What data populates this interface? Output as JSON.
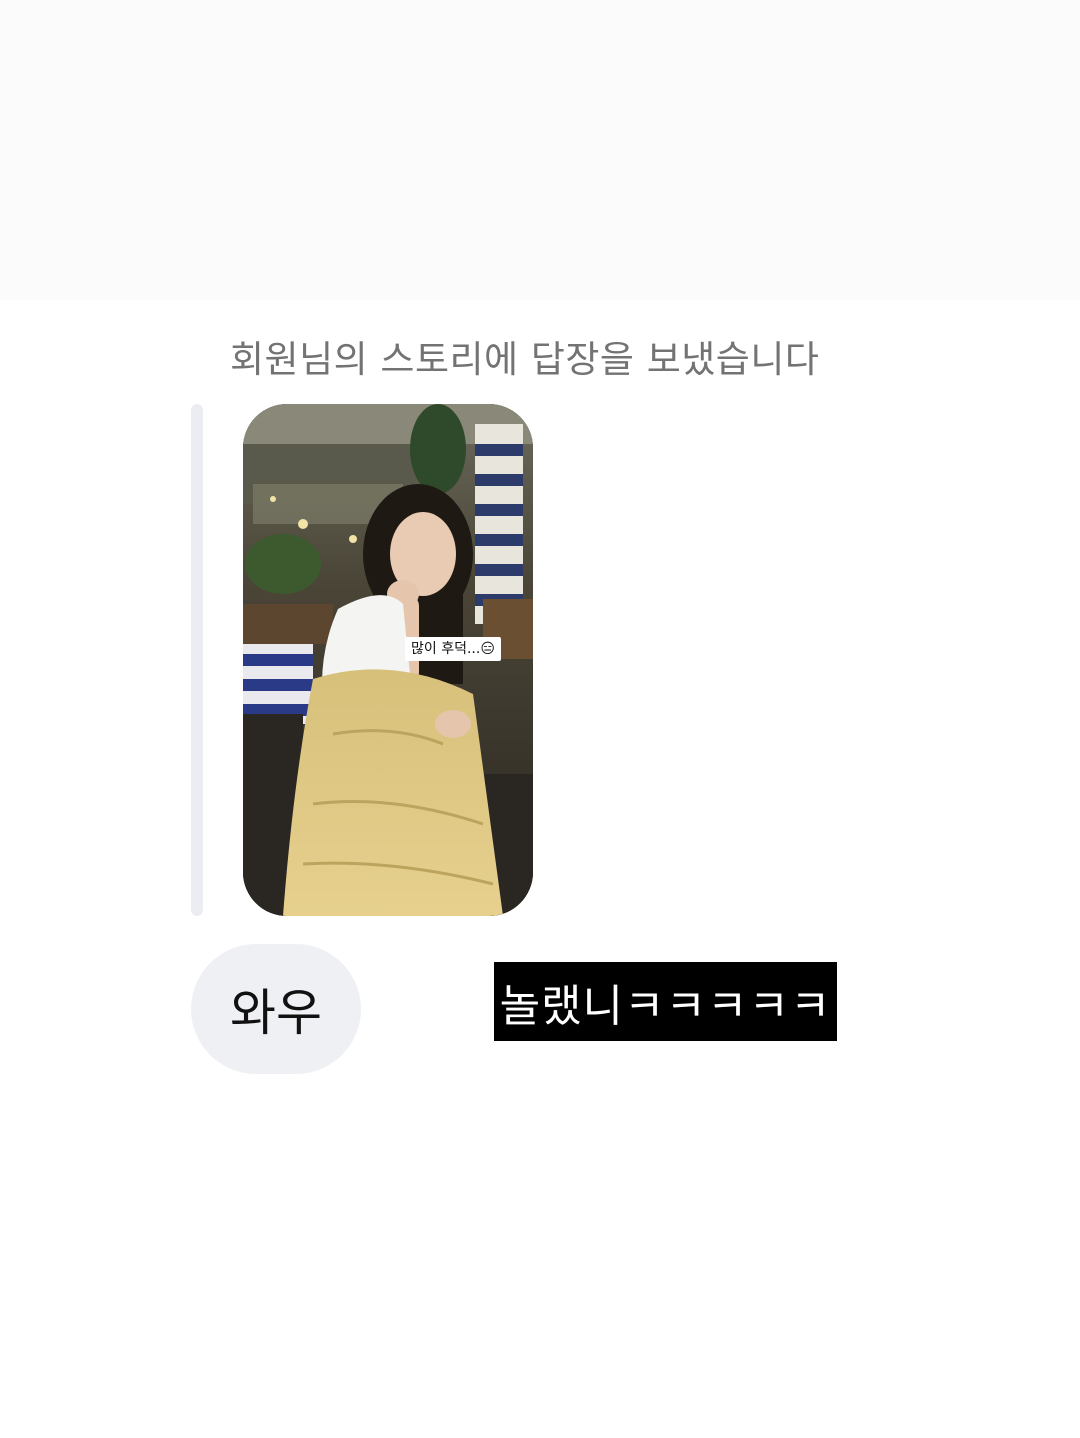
{
  "story_reply": {
    "caption": "회원님의 스토리에 답장을 보냈습니다",
    "story_sticker_text": "많이 후덕...😑"
  },
  "messages": [
    {
      "text": "와우"
    }
  ],
  "overlay": {
    "text": "놀랬니ㅋㅋㅋㅋㅋ"
  },
  "colors": {
    "bubble": "#eff0f4",
    "quote_bar": "#ecedf2",
    "caption_text": "#737373",
    "overlay_bg": "#000000"
  }
}
